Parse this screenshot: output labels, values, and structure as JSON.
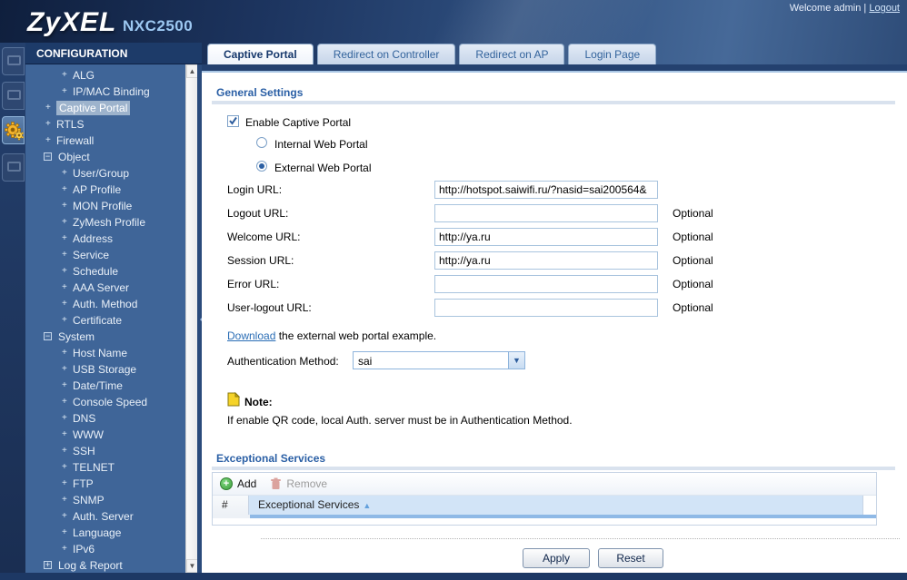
{
  "header": {
    "brand": "ZyXEL",
    "model": "NXC2500",
    "welcome": "Welcome admin",
    "separator": "|",
    "logout": "Logout"
  },
  "rail_icons": [
    "dashboard",
    "monitor",
    "configuration",
    "maintenance"
  ],
  "sidebar": {
    "title": "CONFIGURATION",
    "items": [
      {
        "label": "ALG",
        "level": 2,
        "icon": "arrow",
        "selected": false
      },
      {
        "label": "IP/MAC Binding",
        "level": 2,
        "icon": "arrow",
        "selected": false
      },
      {
        "label": "Captive Portal",
        "level": 1,
        "icon": "arrow",
        "selected": true
      },
      {
        "label": "RTLS",
        "level": 1,
        "icon": "arrow",
        "selected": false
      },
      {
        "label": "Firewall",
        "level": 1,
        "icon": "arrow",
        "selected": false
      },
      {
        "label": "Object",
        "level": 0,
        "icon": "minus",
        "selected": false
      },
      {
        "label": "User/Group",
        "level": 2,
        "icon": "arrow",
        "selected": false
      },
      {
        "label": "AP Profile",
        "level": 2,
        "icon": "arrow",
        "selected": false
      },
      {
        "label": "MON Profile",
        "level": 2,
        "icon": "arrow",
        "selected": false
      },
      {
        "label": "ZyMesh Profile",
        "level": 2,
        "icon": "arrow",
        "selected": false
      },
      {
        "label": "Address",
        "level": 2,
        "icon": "arrow",
        "selected": false
      },
      {
        "label": "Service",
        "level": 2,
        "icon": "arrow",
        "selected": false
      },
      {
        "label": "Schedule",
        "level": 2,
        "icon": "arrow",
        "selected": false
      },
      {
        "label": "AAA Server",
        "level": 2,
        "icon": "arrow",
        "selected": false
      },
      {
        "label": "Auth. Method",
        "level": 2,
        "icon": "arrow",
        "selected": false
      },
      {
        "label": "Certificate",
        "level": 2,
        "icon": "arrow",
        "selected": false
      },
      {
        "label": "System",
        "level": 0,
        "icon": "minus",
        "selected": false
      },
      {
        "label": "Host Name",
        "level": 2,
        "icon": "arrow",
        "selected": false
      },
      {
        "label": "USB Storage",
        "level": 2,
        "icon": "arrow",
        "selected": false
      },
      {
        "label": "Date/Time",
        "level": 2,
        "icon": "arrow",
        "selected": false
      },
      {
        "label": "Console Speed",
        "level": 2,
        "icon": "arrow",
        "selected": false
      },
      {
        "label": "DNS",
        "level": 2,
        "icon": "arrow",
        "selected": false
      },
      {
        "label": "WWW",
        "level": 2,
        "icon": "arrow",
        "selected": false
      },
      {
        "label": "SSH",
        "level": 2,
        "icon": "arrow",
        "selected": false
      },
      {
        "label": "TELNET",
        "level": 2,
        "icon": "arrow",
        "selected": false
      },
      {
        "label": "FTP",
        "level": 2,
        "icon": "arrow",
        "selected": false
      },
      {
        "label": "SNMP",
        "level": 2,
        "icon": "arrow",
        "selected": false
      },
      {
        "label": "Auth. Server",
        "level": 2,
        "icon": "arrow",
        "selected": false
      },
      {
        "label": "Language",
        "level": 2,
        "icon": "arrow",
        "selected": false
      },
      {
        "label": "IPv6",
        "level": 2,
        "icon": "arrow",
        "selected": false
      },
      {
        "label": "Log & Report",
        "level": 0,
        "icon": "plus",
        "selected": false
      }
    ]
  },
  "tabs": [
    {
      "label": "Captive Portal",
      "active": true
    },
    {
      "label": "Redirect on Controller",
      "active": false
    },
    {
      "label": "Redirect on AP",
      "active": false
    },
    {
      "label": "Login Page",
      "active": false
    }
  ],
  "general": {
    "heading": "General Settings",
    "enable_label": "Enable Captive Portal",
    "enable_checked": true,
    "internal_label": "Internal Web Portal",
    "internal_selected": false,
    "external_label": "External Web Portal",
    "external_selected": true,
    "fields": [
      {
        "label": "Login URL:",
        "value": "http://hotspot.saiwifi.ru/?nasid=sai200564&",
        "optional": ""
      },
      {
        "label": "Logout URL:",
        "value": "",
        "optional": "Optional"
      },
      {
        "label": "Welcome URL:",
        "value": "http://ya.ru",
        "optional": "Optional"
      },
      {
        "label": "Session URL:",
        "value": "http://ya.ru",
        "optional": "Optional"
      },
      {
        "label": "Error URL:",
        "value": "",
        "optional": "Optional"
      },
      {
        "label": "User-logout URL:",
        "value": "",
        "optional": "Optional"
      }
    ],
    "download_link": "Download",
    "download_rest": " the external web portal example.",
    "auth_label": "Authentication Method:",
    "auth_value": "sai",
    "note_label": "Note:",
    "note_text": "If enable QR code, local Auth. server must be in Authentication Method."
  },
  "services": {
    "heading": "Exceptional Services",
    "add_label": "Add",
    "remove_label": "Remove",
    "col_index": "#",
    "col_name": "Exceptional Services",
    "sort": "asc",
    "rows": []
  },
  "actions": {
    "apply": "Apply",
    "reset": "Reset"
  },
  "colors": {
    "banner_navy": "#1d3560",
    "sidebar_blue": "#3f6598",
    "heading_blue": "#2a5fa5",
    "tab_active_text": "#16386c",
    "link_blue": "#2a6db5",
    "add_green": "#3f9e3f",
    "remove_red": "#dba39e",
    "grid_header_blue": "#d2e4f7"
  }
}
